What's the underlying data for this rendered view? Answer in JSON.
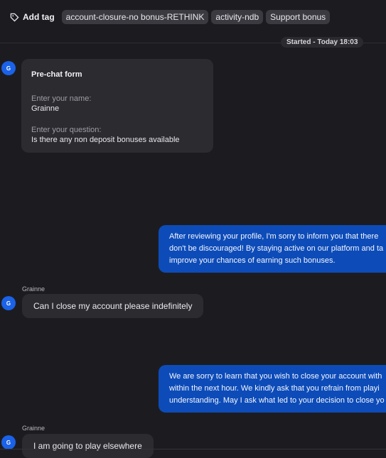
{
  "header": {
    "add_tag_label": "Add tag",
    "tags": [
      "account-closure-no bonus-RETHINK",
      "activity-ndb",
      "Support bonus"
    ]
  },
  "timeline": {
    "started_label": "Started - Today 18:03"
  },
  "avatar_initial": "G",
  "prechat": {
    "title": "Pre-chat form",
    "name_label": "Enter your name:",
    "name_value": "Grainne",
    "question_label": "Enter your question:",
    "question_value": "Is there any non deposit bonuses available"
  },
  "messages": {
    "agent_1": [
      "After reviewing your profile, I'm sorry to inform you that there",
      "don't be discouraged! By staying active on our platform and ta",
      "improve your chances of earning such bonuses."
    ],
    "user_1": {
      "sender": "Grainne",
      "text": "Can I close my account please indefinitely"
    },
    "agent_2": [
      "We are sorry to learn that you wish to close your account with",
      "within the next hour. We kindly ask that you refrain from playi",
      "understanding. May I ask what led to your decision to close yo"
    ],
    "user_2": {
      "sender": "Grainne",
      "text": "I am going to play elsewhere"
    }
  },
  "colors": {
    "agent_bubble": "#0d4cb8",
    "avatar": "#1a62e8",
    "background": "#1c1c20"
  },
  "icons": {
    "add_tag": "tag-icon"
  }
}
